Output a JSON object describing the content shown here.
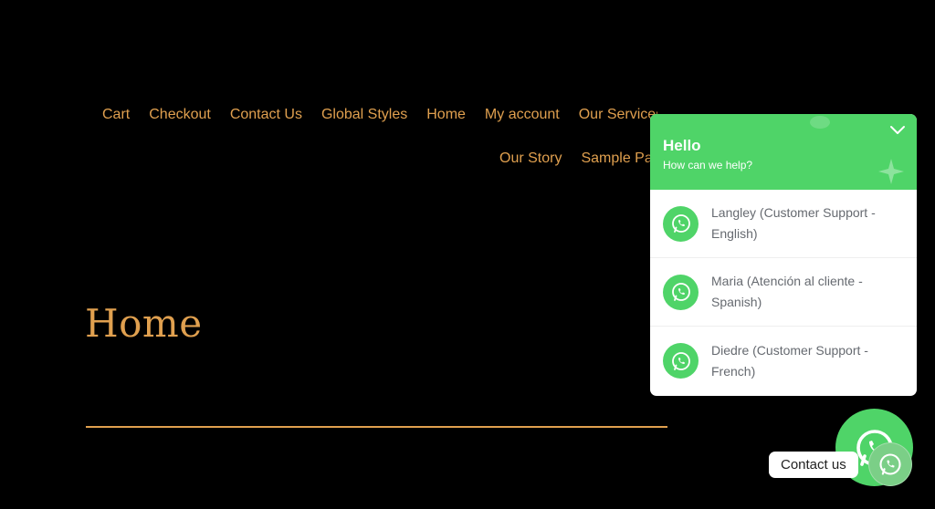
{
  "nav": {
    "row1": [
      "Cart",
      "Checkout",
      "Contact Us",
      "Global Styles",
      "Home",
      "My account",
      "Our Services"
    ],
    "row2": [
      "Our Story",
      "Sample Page"
    ]
  },
  "page": {
    "title": "Home"
  },
  "chat": {
    "title": "Hello",
    "subtitle": "How can we help?",
    "contacts": [
      {
        "name": "Langley (Customer Support - English)"
      },
      {
        "name": "Maria (Atención al cliente - Spanish)"
      },
      {
        "name": "Diedre (Customer Support - French)"
      }
    ],
    "float_label": "Contact us"
  },
  "colors": {
    "background": "#000000",
    "accent": "#e0a04f",
    "whatsapp_green": "#4fd468"
  },
  "icons": [
    "chevron-down-icon",
    "whatsapp-icon"
  ]
}
